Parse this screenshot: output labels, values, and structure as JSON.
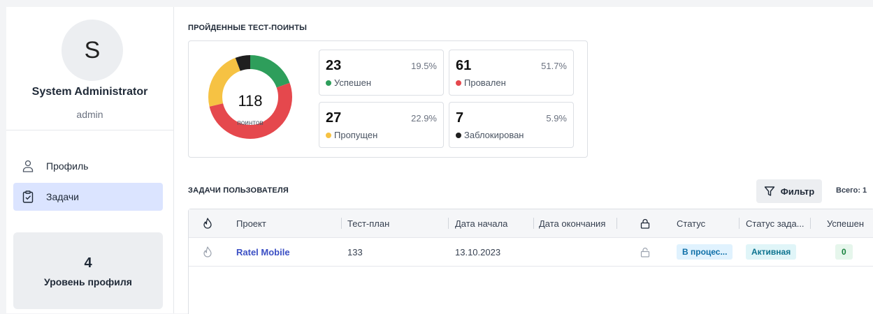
{
  "profile": {
    "avatar_initial": "S",
    "name": "System Administrator",
    "login": "admin"
  },
  "nav": {
    "items": [
      {
        "label": "Профиль",
        "icon": "user-icon",
        "active": false
      },
      {
        "label": "Задачи",
        "icon": "clipboard-check-icon",
        "active": true
      }
    ]
  },
  "level": {
    "value": "4",
    "label": "Уровень профиля"
  },
  "stats": {
    "title": "ПРОЙДЕННЫЕ ТЕСТ-ПОИНТЫ",
    "total": "118",
    "total_label": "поинтов",
    "items": [
      {
        "count": "23",
        "percent": "19.5%",
        "label": "Успешен",
        "color": "#2e9e5b",
        "value": 23
      },
      {
        "count": "61",
        "percent": "51.7%",
        "label": "Провален",
        "color": "#e5484d",
        "value": 61
      },
      {
        "count": "27",
        "percent": "22.9%",
        "label": "Пропущен",
        "color": "#f6c243",
        "value": 27
      },
      {
        "count": "7",
        "percent": "5.9%",
        "label": "Заблокирован",
        "color": "#1f1f1f",
        "value": 7
      }
    ]
  },
  "tasks": {
    "title": "ЗАДАЧИ ПОЛЬЗОВАТЕЛЯ",
    "filter_label": "Фильтр",
    "total_label": "Всего: 1",
    "columns": {
      "project": "Проект",
      "test_plan": "Тест-план",
      "start_date": "Дата начала",
      "end_date": "Дата окончания",
      "status": "Статус",
      "task_status": "Статус зада...",
      "passed": "Успешен"
    },
    "rows": [
      {
        "project": "Ratel Mobile",
        "test_plan": "133",
        "start_date": "13.10.2023",
        "end_date": "",
        "status": "В процес...",
        "task_status": "Активная",
        "passed": "0"
      }
    ]
  },
  "colors": {
    "accent": "#3b4fc4",
    "active_nav_bg": "#dbe4ff"
  }
}
